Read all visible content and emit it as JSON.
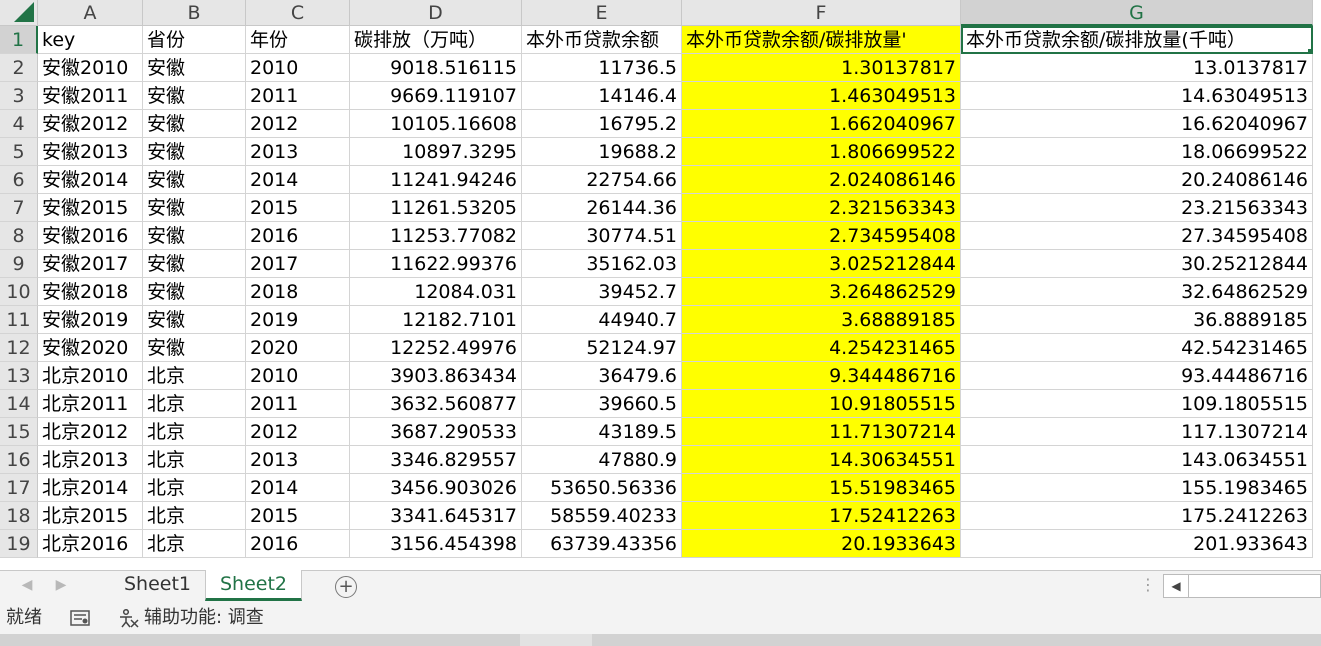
{
  "corner": {
    "label": ""
  },
  "columns": [
    "A",
    "B",
    "C",
    "D",
    "E",
    "F",
    "G"
  ],
  "header_row": {
    "row_number": "1",
    "cells": [
      "key",
      "省份",
      "年份",
      "碳排放（万吨）",
      "本外币贷款余额",
      "本外币贷款余额/碳排放量'",
      "本外币贷款余额/碳排放量(千吨）"
    ]
  },
  "rows": [
    {
      "n": "2",
      "cells": [
        "安徽2010",
        "安徽",
        "2010",
        "9018.516115",
        "11736.5",
        "1.30137817",
        "13.0137817"
      ]
    },
    {
      "n": "3",
      "cells": [
        "安徽2011",
        "安徽",
        "2011",
        "9669.119107",
        "14146.4",
        "1.463049513",
        "14.63049513"
      ]
    },
    {
      "n": "4",
      "cells": [
        "安徽2012",
        "安徽",
        "2012",
        "10105.16608",
        "16795.2",
        "1.662040967",
        "16.62040967"
      ]
    },
    {
      "n": "5",
      "cells": [
        "安徽2013",
        "安徽",
        "2013",
        "10897.3295",
        "19688.2",
        "1.806699522",
        "18.06699522"
      ]
    },
    {
      "n": "6",
      "cells": [
        "安徽2014",
        "安徽",
        "2014",
        "11241.94246",
        "22754.66",
        "2.024086146",
        "20.24086146"
      ]
    },
    {
      "n": "7",
      "cells": [
        "安徽2015",
        "安徽",
        "2015",
        "11261.53205",
        "26144.36",
        "2.321563343",
        "23.21563343"
      ]
    },
    {
      "n": "8",
      "cells": [
        "安徽2016",
        "安徽",
        "2016",
        "11253.77082",
        "30774.51",
        "2.734595408",
        "27.34595408"
      ]
    },
    {
      "n": "9",
      "cells": [
        "安徽2017",
        "安徽",
        "2017",
        "11622.99376",
        "35162.03",
        "3.025212844",
        "30.25212844"
      ]
    },
    {
      "n": "10",
      "cells": [
        "安徽2018",
        "安徽",
        "2018",
        "12084.031",
        "39452.7",
        "3.264862529",
        "32.64862529"
      ]
    },
    {
      "n": "11",
      "cells": [
        "安徽2019",
        "安徽",
        "2019",
        "12182.7101",
        "44940.7",
        "3.68889185",
        "36.8889185"
      ]
    },
    {
      "n": "12",
      "cells": [
        "安徽2020",
        "安徽",
        "2020",
        "12252.49976",
        "52124.97",
        "4.254231465",
        "42.54231465"
      ]
    },
    {
      "n": "13",
      "cells": [
        "北京2010",
        "北京",
        "2010",
        "3903.863434",
        "36479.6",
        "9.344486716",
        "93.44486716"
      ]
    },
    {
      "n": "14",
      "cells": [
        "北京2011",
        "北京",
        "2011",
        "3632.560877",
        "39660.5",
        "10.91805515",
        "109.1805515"
      ]
    },
    {
      "n": "15",
      "cells": [
        "北京2012",
        "北京",
        "2012",
        "3687.290533",
        "43189.5",
        "11.71307214",
        "117.1307214"
      ]
    },
    {
      "n": "16",
      "cells": [
        "北京2013",
        "北京",
        "2013",
        "3346.829557",
        "47880.9",
        "14.30634551",
        "143.0634551"
      ]
    },
    {
      "n": "17",
      "cells": [
        "北京2014",
        "北京",
        "2014",
        "3456.903026",
        "53650.56336",
        "15.51983465",
        "155.1983465"
      ]
    },
    {
      "n": "18",
      "cells": [
        "北京2015",
        "北京",
        "2015",
        "3341.645317",
        "58559.40233",
        "17.52412263",
        "175.2412263"
      ]
    },
    {
      "n": "19",
      "cells": [
        "北京2016",
        "北京",
        "2016",
        "3156.454398",
        "63739.43356",
        "20.1933643",
        "201.933643"
      ]
    }
  ],
  "sheet_tabs": [
    {
      "label": "Sheet1",
      "active": false
    },
    {
      "label": "Sheet2",
      "active": true
    }
  ],
  "add_sheet_label": "+",
  "status_bar": {
    "ready": "就绪",
    "accessibility": "辅助功能: 调查"
  },
  "colors": {
    "highlight": "#ffff00",
    "accent": "#217346"
  }
}
